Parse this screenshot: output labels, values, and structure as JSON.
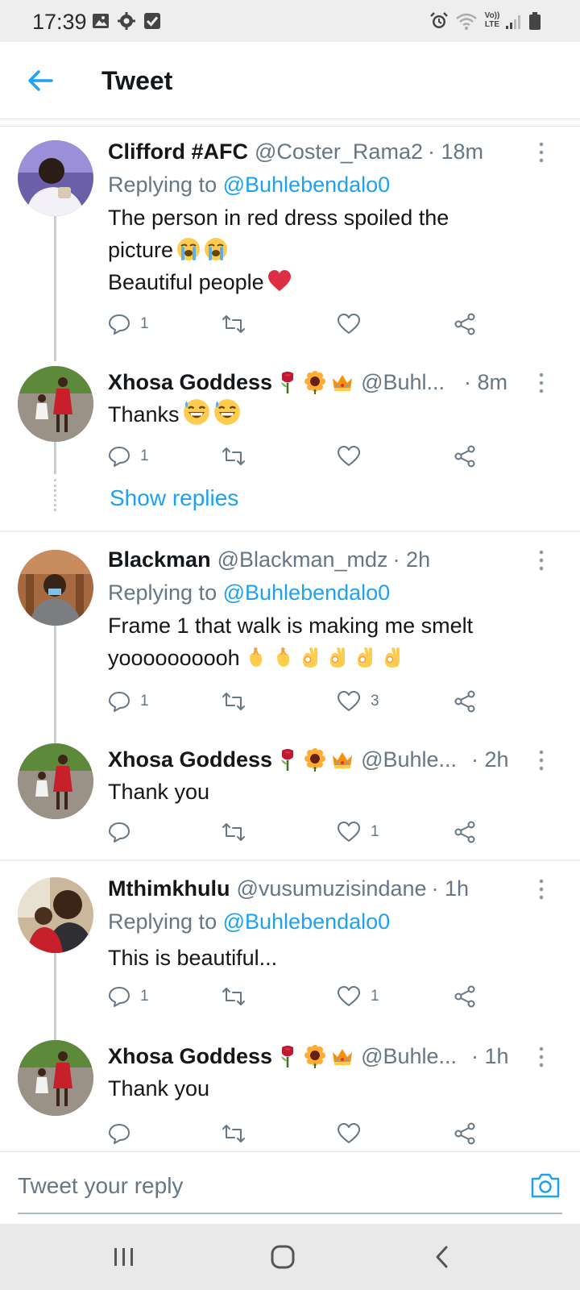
{
  "status_bar": {
    "time": "17:39",
    "network_label": "Vo)) LTE"
  },
  "header": {
    "title": "Tweet"
  },
  "threads": [
    {
      "tweets": [
        {
          "name": "Clifford #AFC",
          "handle": "@Coster_Rama2",
          "time": "· 18m",
          "reply_prefix": "Replying to",
          "reply_to": "@Buhlebendalo0",
          "text_lines": [
            "The person in red dress spoiled the",
            "picture",
            "Beautiful people"
          ],
          "emojis": [
            "loudly-crying-face",
            "loudly-crying-face",
            "red-heart"
          ],
          "counts": {
            "replies": "1",
            "retweets": "",
            "likes": ""
          }
        },
        {
          "name": "Xhosa Goddess",
          "name_emojis": [
            "rose",
            "sunflower",
            "crown"
          ],
          "handle": "@Buhl...",
          "time": "· 8m",
          "text_lines": [
            "Thanks"
          ],
          "emojis": [
            "grinning-face-with-sweat",
            "grinning-face-with-sweat"
          ],
          "counts": {
            "replies": "1",
            "retweets": "",
            "likes": ""
          }
        }
      ],
      "show_replies": "Show replies"
    },
    {
      "tweets": [
        {
          "name": "Blackman",
          "handle": "@Blackman_mdz",
          "time": "· 2h",
          "reply_prefix": "Replying to",
          "reply_to": "@Buhlebendalo0",
          "text_lines": [
            "Frame 1 that walk is making me smelt",
            "yoooooooooh"
          ],
          "emojis": [
            "crossed-fingers",
            "crossed-fingers",
            "ok-hand",
            "ok-hand",
            "ok-hand",
            "ok-hand"
          ],
          "counts": {
            "replies": "1",
            "retweets": "",
            "likes": "3"
          }
        },
        {
          "name": "Xhosa Goddess",
          "name_emojis": [
            "rose",
            "sunflower",
            "crown"
          ],
          "handle": "@Buhle...",
          "time": "· 2h",
          "text_lines": [
            "Thank you"
          ],
          "counts": {
            "replies": "",
            "retweets": "",
            "likes": "1"
          }
        }
      ]
    },
    {
      "tweets": [
        {
          "name": "Mthimkhulu",
          "handle": "@vusumuzisindane",
          "time": "· 1h",
          "reply_prefix": "Replying to",
          "reply_to": "@Buhlebendalo0",
          "text_lines": [
            "This is beautiful..."
          ],
          "counts": {
            "replies": "1",
            "retweets": "",
            "likes": "1"
          }
        },
        {
          "name": "Xhosa Goddess",
          "name_emojis": [
            "rose",
            "sunflower",
            "crown"
          ],
          "handle": "@Buhle...",
          "time": "· 1h",
          "text_lines": [
            "Thank you"
          ]
        }
      ]
    }
  ],
  "reply_bar": {
    "placeholder": "Tweet your reply"
  },
  "colors": {
    "accent": "#1da1f2",
    "secondary_text": "#657786",
    "heart": "#dd2e44"
  }
}
